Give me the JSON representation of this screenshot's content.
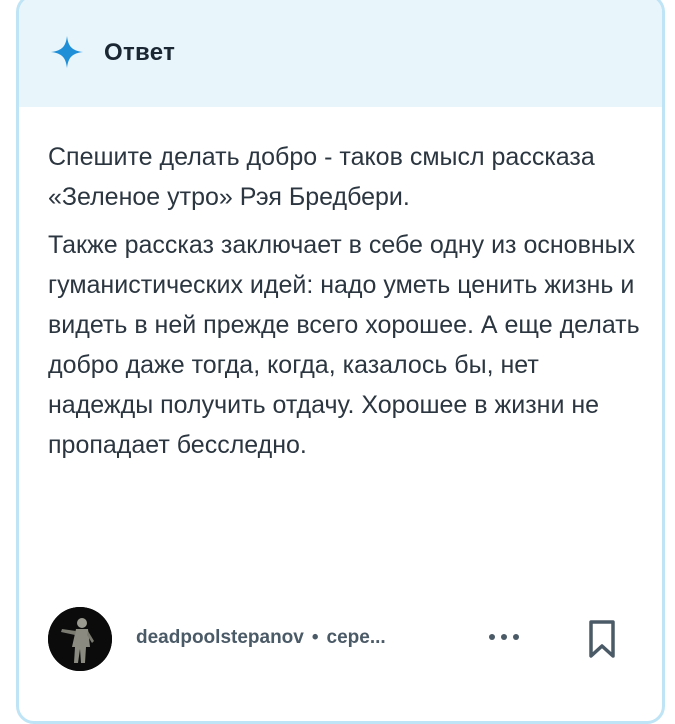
{
  "header": {
    "title": "Ответ",
    "icon": "sparkle-icon",
    "accent_color": "#1f8fd8",
    "background_color": "#e8f5fb"
  },
  "answer": {
    "paragraphs": [
      "Спешите делать добро - таков смысл рассказа «Зеленое утро» Рэя Бредбери.",
      "Также рассказ заключает в себе одну из основных гуманистических идей: надо уметь ценить жизнь и видеть в ней прежде всего хорошее. А еще делать добро даже тогда, когда, казалось бы, нет надежды получить отдачу. Хорошее в жизни не пропадает бесследно."
    ]
  },
  "author": {
    "username": "deadpoolstepanov",
    "separator": "•",
    "rank": "сере...",
    "more_icon": "more-dots-icon",
    "bookmark_icon": "bookmark-icon"
  }
}
